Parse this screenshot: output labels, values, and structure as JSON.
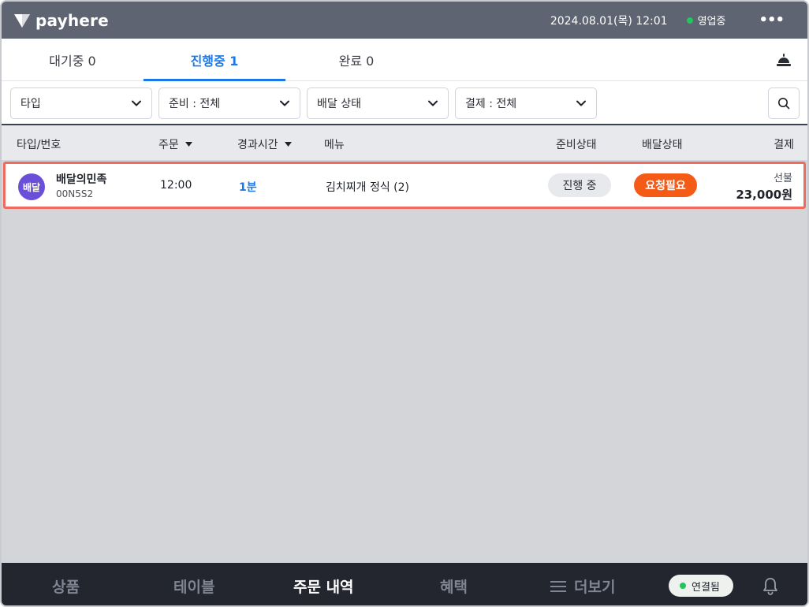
{
  "header": {
    "logo_text": "payhere",
    "datetime": "2024.08.01(목) 12:01",
    "status": "영업중",
    "status_color": "#22c55e",
    "more_icon": "•••"
  },
  "tabs": [
    {
      "label": "대기중 0",
      "active": false
    },
    {
      "label": "진행중 1",
      "active": true
    },
    {
      "label": "완료 0",
      "active": false
    }
  ],
  "filters": {
    "type": "타입",
    "prep": "준비 : 전체",
    "delivery": "배달 상태",
    "payment": "결제 : 전체"
  },
  "table": {
    "headers": {
      "type_number": "타입/번호",
      "order": "주문",
      "elapsed": "경과시간",
      "menu": "메뉴",
      "prep_status": "준비상태",
      "delivery_status": "배달상태",
      "payment": "결제"
    },
    "rows": [
      {
        "type_badge": "배달",
        "store": "배달의민족",
        "code": "00N5S2",
        "order_time": "12:00",
        "elapsed": "1분",
        "menu": "김치찌개 정식 (2)",
        "prep_status": "진행 중",
        "delivery_status": "요청필요",
        "pay_type": "선불",
        "amount": "23,000원"
      }
    ]
  },
  "bottom_nav": {
    "items": [
      "상품",
      "테이블",
      "주문 내역",
      "혜택",
      "더보기"
    ],
    "active": "주문 내역",
    "connection": "연결됨",
    "connection_color": "#22c55e"
  },
  "colors": {
    "accent": "#1a78e8",
    "delivery_badge": "#f45b16",
    "type_badge": "#6a4fd8",
    "highlight_border": "#ee6b5e"
  }
}
